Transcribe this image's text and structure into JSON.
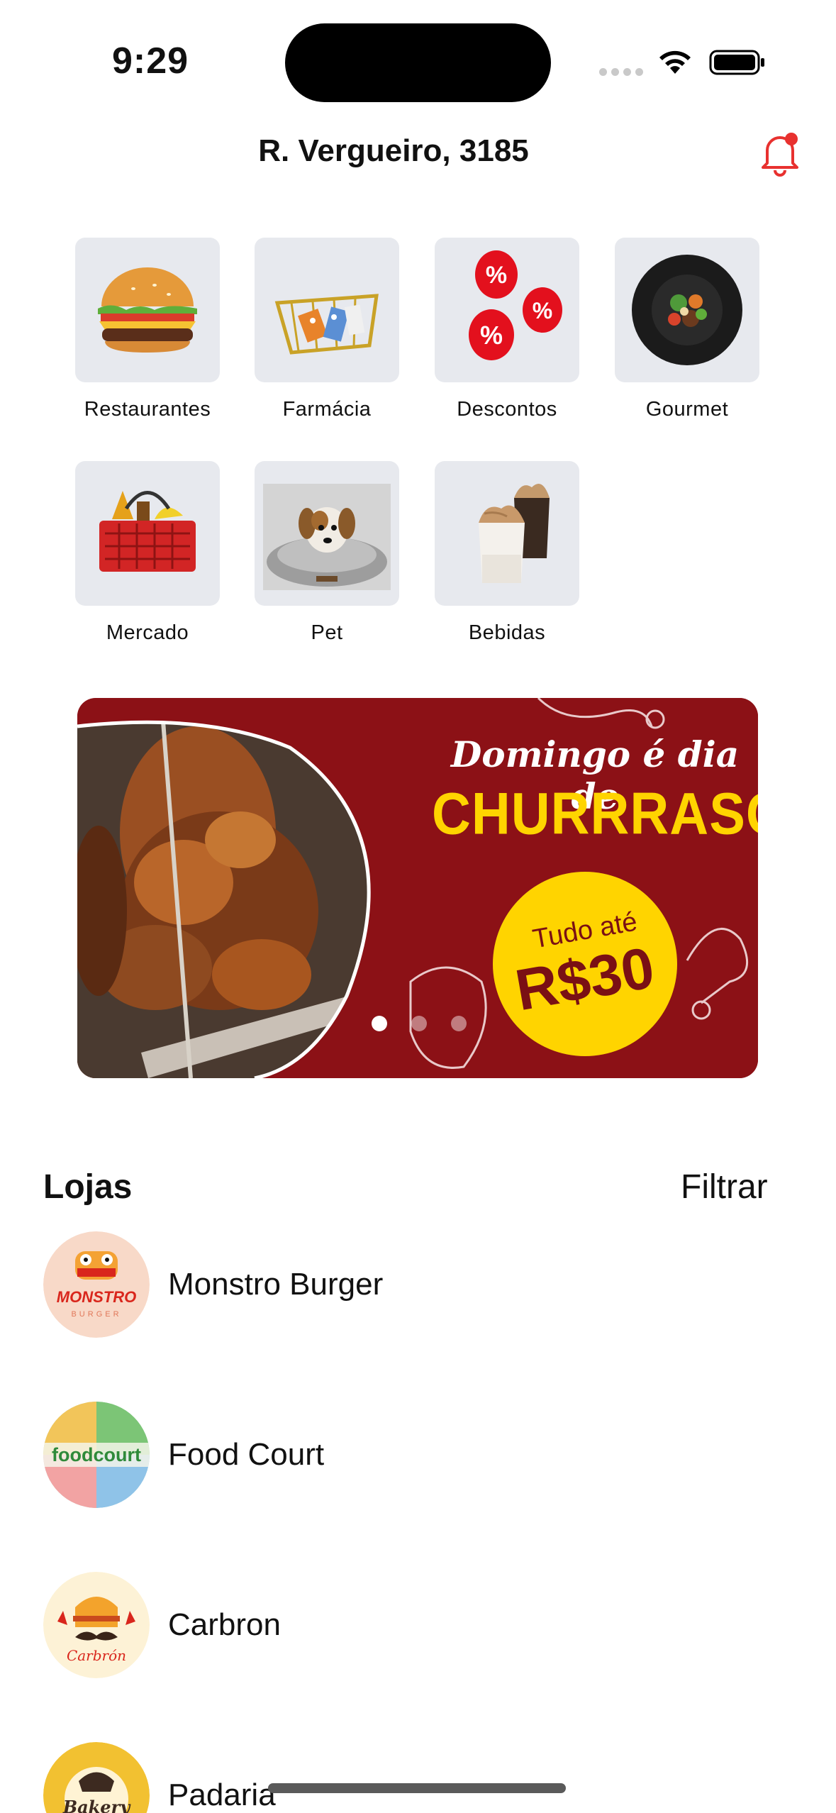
{
  "status_bar": {
    "time": "9:29"
  },
  "header": {
    "address": "R. Vergueiro, 3185"
  },
  "categories": [
    {
      "label": "Restaurantes",
      "icon": "burger-icon"
    },
    {
      "label": "Farmácia",
      "icon": "pharmacy-basket-icon"
    },
    {
      "label": "Descontos",
      "icon": "discount-balloons-icon"
    },
    {
      "label": "Gourmet",
      "icon": "gourmet-plate-icon"
    },
    {
      "label": "Mercado",
      "icon": "grocery-basket-icon"
    },
    {
      "label": "Pet",
      "icon": "dog-bed-icon"
    },
    {
      "label": "Bebidas",
      "icon": "coffee-cups-icon"
    }
  ],
  "banner": {
    "line1": "Domingo é dia de",
    "line2": "CHURRRASCO",
    "price_prefix": "Tudo até",
    "price": "R$30",
    "slide_count": 3,
    "active_slide": 1
  },
  "stores": {
    "title": "Lojas",
    "filter_label": "Filtrar",
    "items": [
      {
        "name": "Monstro Burger",
        "logo_text": "MONSTRO",
        "logo_sub": "BURGER"
      },
      {
        "name": "Food Court",
        "logo_text": "foodcourt"
      },
      {
        "name": "Carbron",
        "logo_text": "Carbrón"
      },
      {
        "name": "Padaria",
        "logo_text": "Bakery"
      }
    ]
  },
  "colors": {
    "accent_red": "#e8312f",
    "banner_red": "#8c1116",
    "banner_yellow": "#ffd400",
    "tile_bg": "#e7e9ee"
  }
}
